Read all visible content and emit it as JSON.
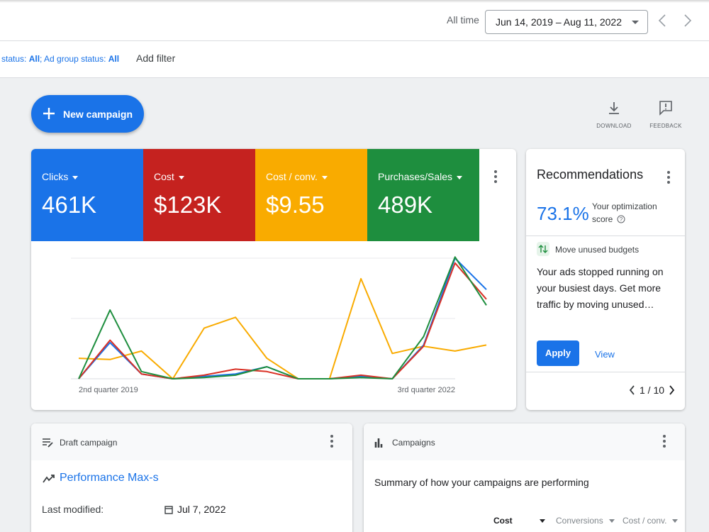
{
  "header": {
    "range_label": "All time",
    "date_range": "Jun 14, 2019 – Aug 11, 2022"
  },
  "filter_bar": {
    "prefix": "status: ",
    "status_value": "All",
    "middle": "; Ad group status: ",
    "ad_group_value": "All",
    "add_filter_label": "Add filter"
  },
  "toolbar": {
    "new_campaign_label": "New campaign",
    "download_label": "DOWNLOAD",
    "feedback_label": "FEEDBACK"
  },
  "metrics": [
    {
      "name": "Clicks",
      "value": "461K",
      "color": "#1a73e8"
    },
    {
      "name": "Cost",
      "value": "$123K",
      "color": "#c5221f"
    },
    {
      "name": "Cost / conv.",
      "value": "$9.55",
      "color": "#f9ab00"
    },
    {
      "name": "Purchases/Sales",
      "value": "489K",
      "color": "#1e8e3e"
    }
  ],
  "chart_data": {
    "type": "line",
    "x_labels": [
      "2nd quarter 2019",
      "3rd quarter 2022"
    ],
    "x": [
      0,
      1,
      2,
      3,
      4,
      5,
      6,
      7,
      8,
      9,
      10,
      11,
      12,
      13
    ],
    "ylim": [
      0,
      100
    ],
    "grid": true,
    "series": [
      {
        "color": "#1a73e8",
        "values": [
          0,
          30,
          4,
          0,
          2,
          4,
          10,
          0,
          0,
          2,
          0,
          28,
          100,
          74
        ]
      },
      {
        "color": "#d93025",
        "values": [
          0,
          32,
          4,
          0,
          3,
          8,
          6,
          0,
          0,
          3,
          0,
          27,
          96,
          66
        ]
      },
      {
        "color": "#1e8e3e",
        "values": [
          0,
          57,
          6,
          0,
          1,
          3,
          10,
          0,
          0,
          1,
          0,
          35,
          101,
          61
        ]
      },
      {
        "color": "#f9ab00",
        "values": [
          17,
          16,
          23,
          0,
          42,
          51,
          17,
          0,
          0,
          83,
          21,
          27,
          23,
          28
        ]
      }
    ]
  },
  "recommendations": {
    "title": "Recommendations",
    "score": "73.1%",
    "score_label": "Your optimization score",
    "type_label": "Move unused budgets",
    "body": "Your ads stopped running on your busiest days. Get more traffic by moving unused…",
    "apply_label": "Apply",
    "view_label": "View",
    "pager": "1 / 10"
  },
  "draft_card": {
    "title": "Draft campaign",
    "campaign_name": "Performance Max-s",
    "last_modified_label": "Last modified:",
    "last_modified_value": "Jul 7, 2022"
  },
  "campaigns_card": {
    "title": "Campaigns",
    "summary": "Summary of how your campaigns are performing",
    "columns": [
      "Cost",
      "Conversions",
      "Cost / conv."
    ]
  }
}
